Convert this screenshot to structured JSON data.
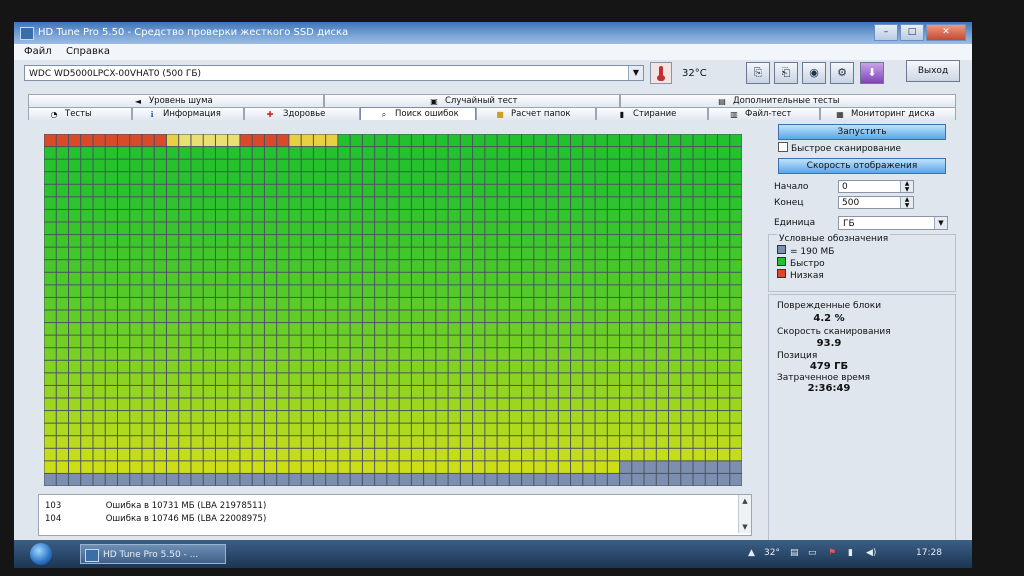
{
  "window": {
    "title": "HD Tune Pro 5.50 - Средство проверки жесткого SSD диска"
  },
  "menu": [
    "Файл",
    "Справка"
  ],
  "toolbar": {
    "drive": "WDC WD5000LPCX-00VHAT0 (500 ГБ)",
    "temperature": "32°C",
    "exit_label": "Выход",
    "buttons": [
      "copy-icon",
      "copy-text-icon",
      "camera-icon",
      "settings-icon",
      "download-icon"
    ]
  },
  "tabs_top": [
    {
      "label": "Уровень шума",
      "icon": "speaker-icon"
    },
    {
      "label": "Случайный тест",
      "icon": "dice-icon"
    },
    {
      "label": "Дополнительные тесты",
      "icon": "tests-icon"
    }
  ],
  "tabs_bottom": [
    {
      "label": "Тесты",
      "icon": "benchmark-icon"
    },
    {
      "label": "Информация",
      "icon": "info-icon"
    },
    {
      "label": "Здоровье",
      "icon": "health-icon"
    },
    {
      "label": "Поиск ошибок",
      "icon": "error-scan-icon",
      "active": true
    },
    {
      "label": "Расчет папок",
      "icon": "folder-icon"
    },
    {
      "label": "Стирание",
      "icon": "erase-icon"
    },
    {
      "label": "Файл-тест",
      "icon": "file-test-icon"
    },
    {
      "label": "Мониторинг диска",
      "icon": "monitor-icon"
    }
  ],
  "scan_grid": {
    "columns": 57,
    "rows": 28,
    "cells_scanned_fraction": 0.958,
    "first_row_markers": [
      {
        "from": 0,
        "to": 9,
        "color": "#d84a2a"
      },
      {
        "from": 10,
        "to": 10,
        "color": "#e8d040"
      },
      {
        "from": 11,
        "to": 15,
        "color": "#e8e070"
      },
      {
        "from": 16,
        "to": 19,
        "color": "#d84a2a"
      },
      {
        "from": 20,
        "to": 23,
        "color": "#e8d040"
      }
    ],
    "colors": {
      "ok_top": "#22c22e",
      "ok_bottom": "#d8e018",
      "unscanned": "#7c8fb0",
      "damaged": "#d84a2a",
      "gridline": "#4b535e"
    }
  },
  "log": [
    {
      "num": "103",
      "text": "Ошибка в 10731 МБ (LBA 21978511)"
    },
    {
      "num": "104",
      "text": "Ошибка в 10746 МБ (LBA 22008975)"
    }
  ],
  "controls": {
    "start_label": "Запустить",
    "quick_scan_label": "Быстрое сканирование",
    "speed_label": "Скорость отображения",
    "start_field_label": "Начало",
    "start_value": "0",
    "end_field_label": "Конец",
    "end_value": "500",
    "unit_label": "Единица",
    "unit_value": "ГБ"
  },
  "legend": {
    "title": "Условные обозначения",
    "items": [
      {
        "label": "= 190 МБ",
        "color": "#7c8fb0"
      },
      {
        "label": "Быстро",
        "color": "#22c22e"
      },
      {
        "label": "Низкая",
        "color": "#d84a2a"
      }
    ]
  },
  "stats": {
    "damaged_label": "Поврежденные блоки",
    "damaged_value": "4.2 %",
    "speed_label": "Скорость сканирования",
    "speed_value": "93.9",
    "position_label": "Позиция",
    "position_value": "479 ГБ",
    "elapsed_label": "Затраченное время",
    "elapsed_value": "2:36:49"
  },
  "taskbar": {
    "task_label": "HD Tune Pro 5.50 - ...",
    "tray_temp": "32°",
    "clock": "17:28"
  }
}
